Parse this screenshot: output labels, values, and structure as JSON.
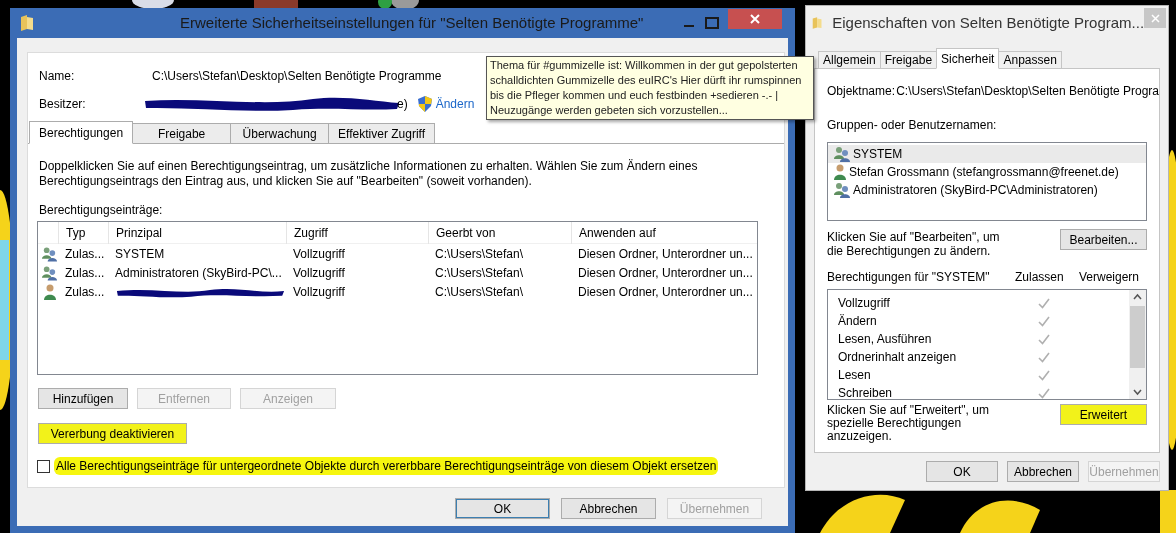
{
  "advanced_window": {
    "title": "Erweiterte Sicherheitseinstellungen für \"Selten Benötigte Programme\"",
    "name_label": "Name:",
    "name_value": "C:\\Users\\Stefan\\Desktop\\Selten Benötigte Programme",
    "owner_label": "Besitzer:",
    "owner_visible_tail": "e)",
    "change_owner_link": "Ändern",
    "tabs": [
      {
        "label": "Berechtigungen",
        "selected": true
      },
      {
        "label": "Freigabe",
        "selected": false
      },
      {
        "label": "Überwachung",
        "selected": false
      },
      {
        "label": "Effektiver Zugriff",
        "selected": false
      }
    ],
    "description": "Doppelklicken Sie auf einen Berechtigungseintrag, um zusätzliche Informationen zu erhalten. Wählen Sie zum Ändern eines Berechtigungseintrags den Eintrag aus, und klicken Sie auf \"Bearbeiten\" (soweit vorhanden).",
    "entries_label": "Berechtigungseinträge:",
    "table": {
      "columns": [
        "Typ",
        "Prinzipal",
        "Zugriff",
        "Geerbt von",
        "Anwenden auf"
      ],
      "rows": [
        {
          "kind": "group",
          "type": "Zulas...",
          "principal": "SYSTEM",
          "access": "Vollzugriff",
          "inherited_from": "C:\\Users\\Stefan\\",
          "applies_to": "Diesen Ordner, Unterordner un..."
        },
        {
          "kind": "group",
          "type": "Zulas...",
          "principal": "Administratoren (SkyBird-PC\\...",
          "access": "Vollzugriff",
          "inherited_from": "C:\\Users\\Stefan\\",
          "applies_to": "Diesen Ordner, Unterordner un..."
        },
        {
          "kind": "user",
          "type": "Zulas...",
          "access": "Vollzugriff",
          "inherited_from": "C:\\Users\\Stefan\\",
          "applies_to": "Diesen Ordner, Unterordner un..."
        }
      ]
    },
    "entry_buttons": [
      {
        "label": "Hinzufügen",
        "disabled": false
      },
      {
        "label": "Entfernen",
        "disabled": true
      },
      {
        "label": "Anzeigen",
        "disabled": true
      }
    ],
    "inheritance_button": {
      "label": "Vererbung deaktivieren",
      "highlighted": true
    },
    "replace_checkbox": {
      "label": "Alle Berechtigungseinträge für untergeordnete Objekte durch vererbbare Berechtigungseinträge von diesem Objekt ersetzen",
      "checked": false,
      "highlighted": true
    },
    "footer_buttons": [
      {
        "label": "OK",
        "disabled": false,
        "default": true
      },
      {
        "label": "Abbrechen",
        "disabled": false,
        "default": false
      },
      {
        "label": "Übernehmen",
        "disabled": true,
        "default": false
      }
    ]
  },
  "tooltip": {
    "text": "Thema für #gummizelle ist: Willkommen in der gut gepolsterten schalldichten Gummizelle des euIRC's Hier dürft ihr rumspinnen bis die Pfleger kommen und euch festbinden +sedieren -.-  | Neuzugänge werden gebeten sich vorzustellen..."
  },
  "properties_window": {
    "title": "Eigenschaften von Selten Benötigte Program...",
    "tabs": [
      {
        "label": "Allgemein",
        "selected": false
      },
      {
        "label": "Freigabe",
        "selected": false
      },
      {
        "label": "Sicherheit",
        "selected": true
      },
      {
        "label": "Anpassen",
        "selected": false
      }
    ],
    "object_label": "Objektname:",
    "object_value": "C:\\Users\\Stefan\\Desktop\\Selten Benötigte Progra",
    "users_label": "Gruppen- oder Benutzernamen:",
    "users": [
      {
        "kind": "group",
        "name": "SYSTEM",
        "selected": true
      },
      {
        "kind": "user",
        "name": "Stefan Grossmann (stefangrossmann@freenet.de)",
        "selected": false
      },
      {
        "kind": "group",
        "name": "Administratoren (SkyBird-PC\\Administratoren)",
        "selected": false
      }
    ],
    "edit_hint": "Klicken Sie auf \"Bearbeiten\", um die Berechtigungen zu ändern.",
    "edit_button": {
      "label": "Bearbeiten...",
      "highlighted": false
    },
    "permissions_label": "Berechtigungen für \"SYSTEM\"",
    "allow_header": "Zulassen",
    "deny_header": "Verweigern",
    "permissions": [
      {
        "name": "Vollzugriff",
        "allow": true
      },
      {
        "name": "Ändern",
        "allow": true
      },
      {
        "name": "Lesen, Ausführen",
        "allow": true
      },
      {
        "name": "Ordnerinhalt anzeigen",
        "allow": true
      },
      {
        "name": "Lesen",
        "allow": true
      },
      {
        "name": "Schreiben",
        "allow": true
      }
    ],
    "advanced_hint": "Klicken Sie auf \"Erweitert\", um spezielle Berechtigungen anzuzeigen.",
    "advanced_button": {
      "label": "Erweitert",
      "highlighted": true
    },
    "footer_buttons": [
      {
        "label": "OK",
        "disabled": false,
        "default": false
      },
      {
        "label": "Abbrechen",
        "disabled": false,
        "default": false
      },
      {
        "label": "Übernehmen",
        "disabled": true,
        "default": false
      }
    ]
  }
}
